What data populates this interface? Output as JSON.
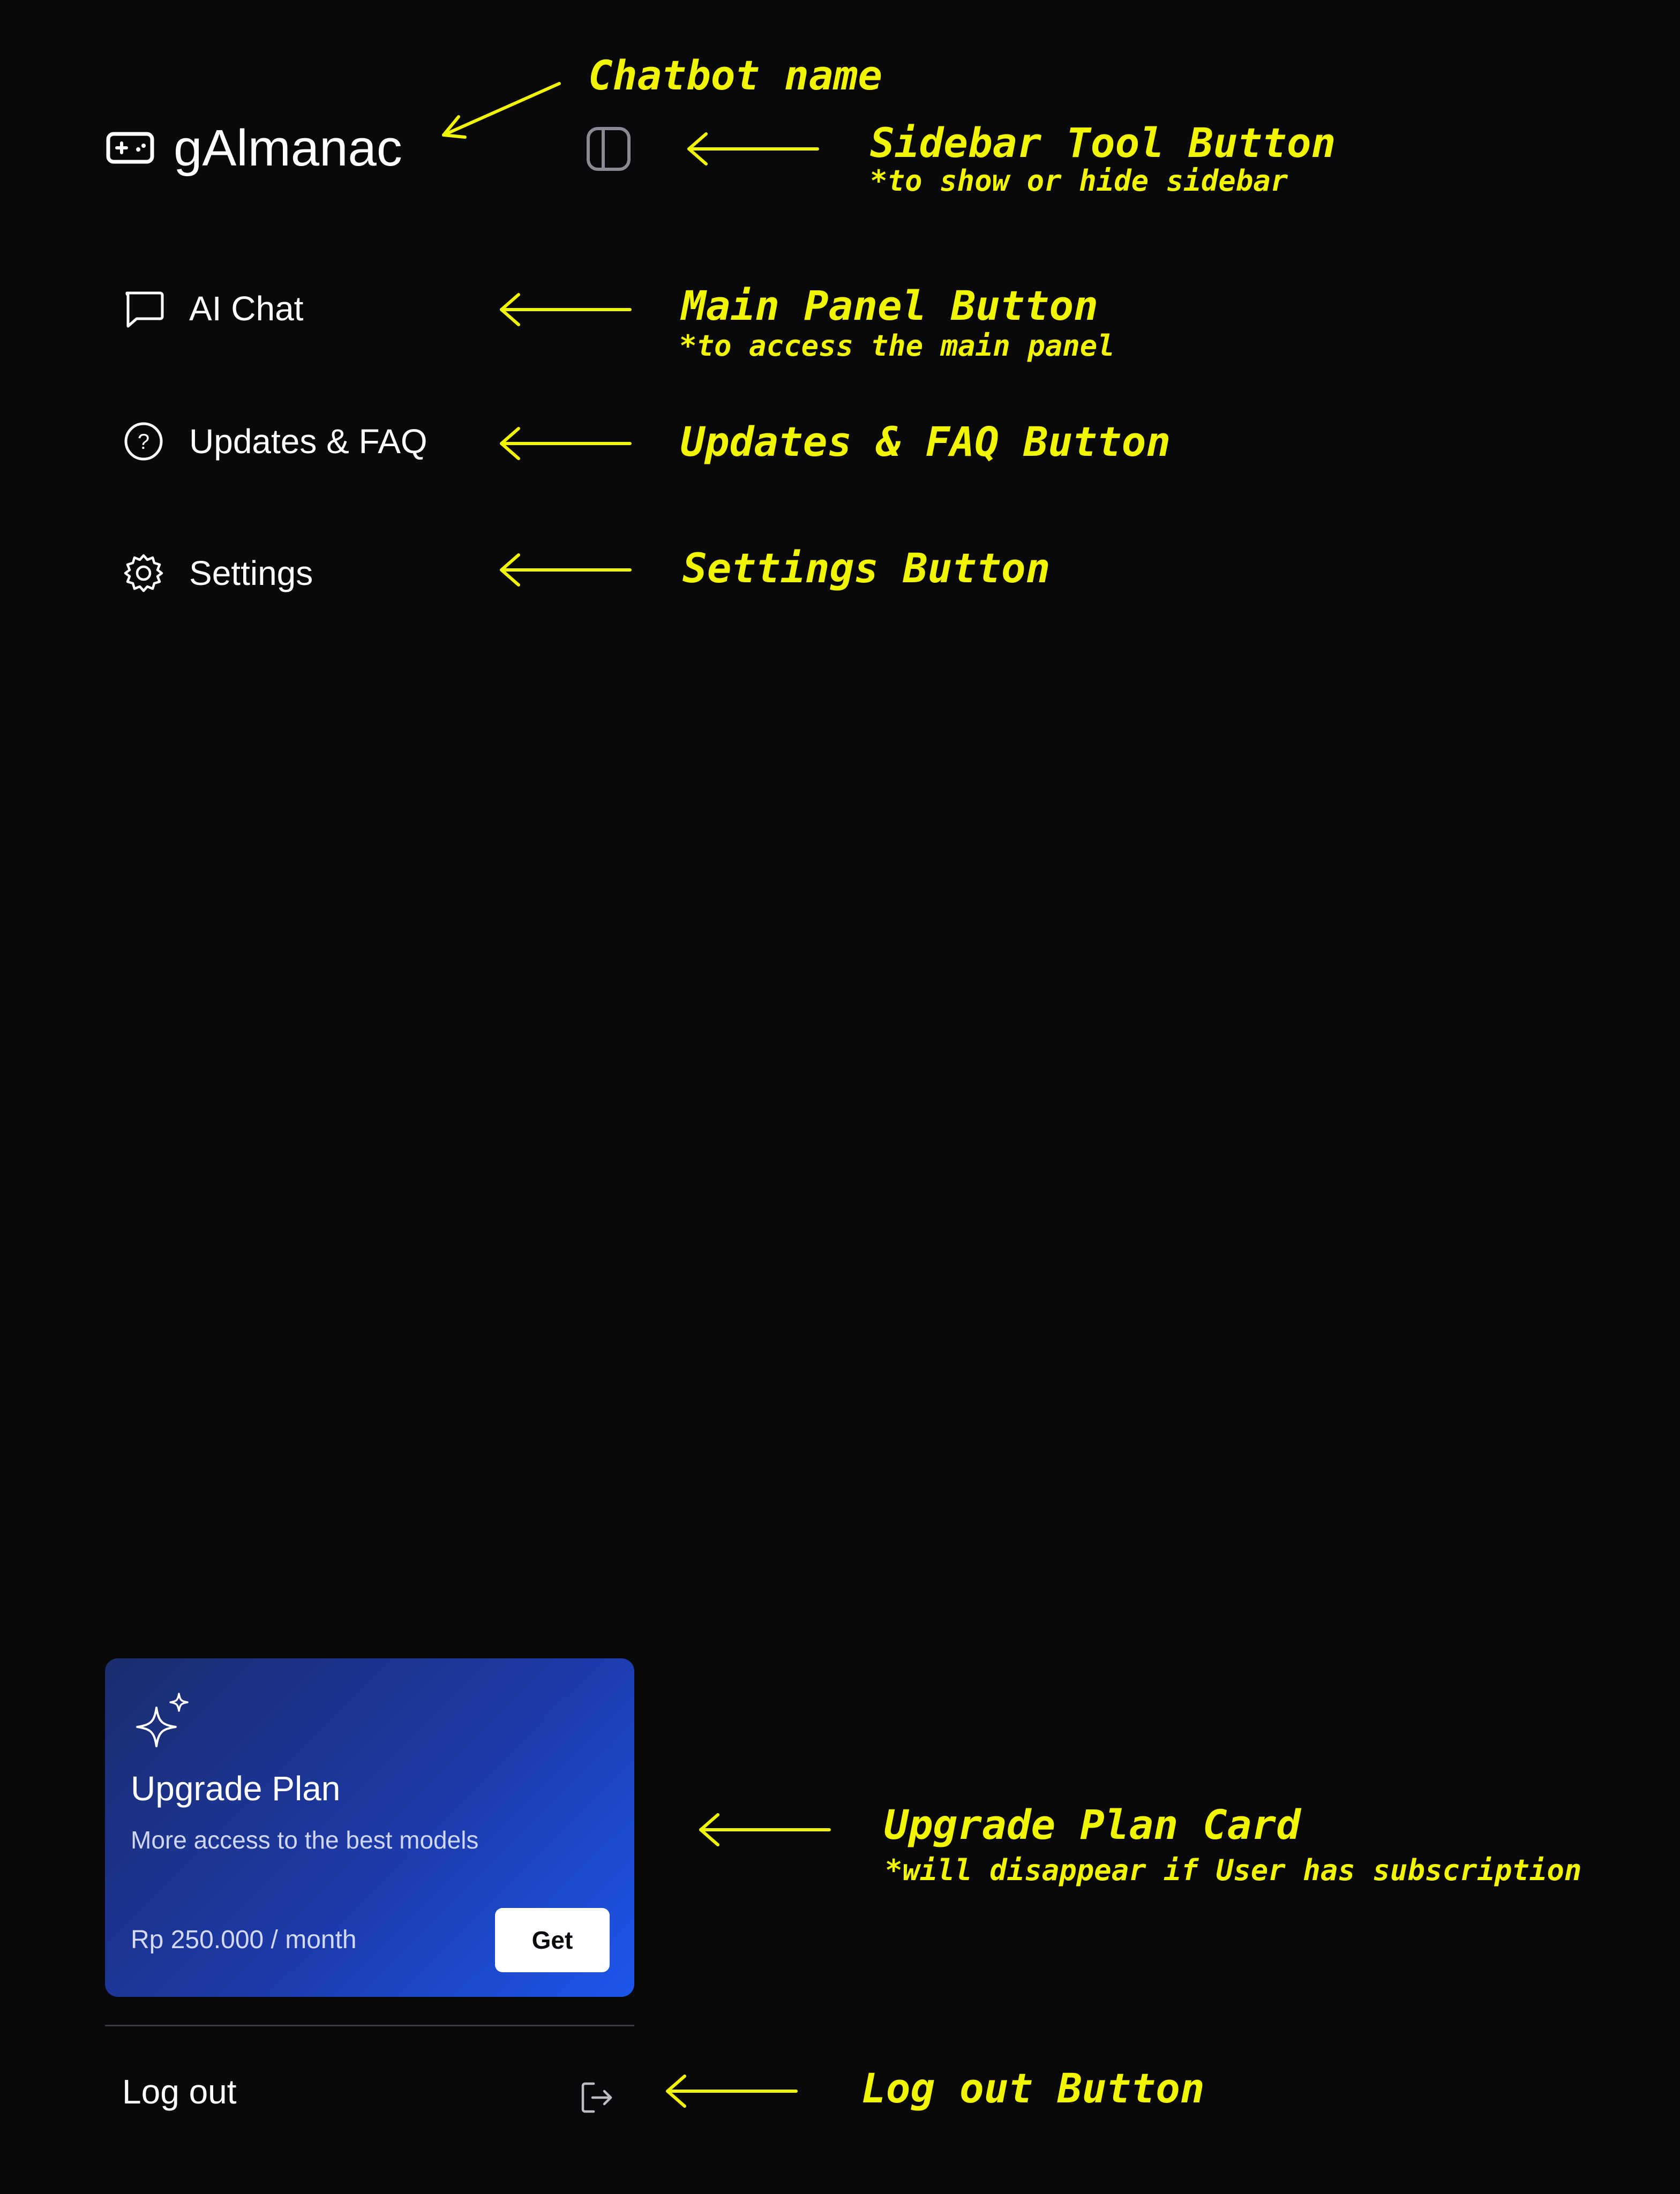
{
  "sidebar": {
    "brand": {
      "icon": "gamepad-icon",
      "name": "gAlmanac"
    },
    "toggle_icon": "sidebar-panel-icon",
    "nav": [
      {
        "icon": "chat-bubble-icon",
        "label": "AI Chat"
      },
      {
        "icon": "question-circle-icon",
        "label": "Updates & FAQ"
      },
      {
        "icon": "gear-icon",
        "label": "Settings"
      }
    ],
    "upgrade_card": {
      "icon": "sparkle-icon",
      "title": "Upgrade Plan",
      "subtitle": "More access to the best models",
      "price": "Rp 250.000 / month",
      "button_label": "Get",
      "colors": {
        "start": "#1b2c6e",
        "end": "#1d56ec"
      }
    },
    "logout": {
      "label": "Log out",
      "icon": "logout-icon"
    }
  },
  "annotations": {
    "color": "#f1f500",
    "chatbot_name": "Chatbot name",
    "sidebar_tool": "Sidebar Tool Button",
    "sidebar_tool_note": "*to show or hide sidebar",
    "main_panel": "Main Panel Button",
    "main_panel_note": "*to access the main panel",
    "updates_faq": "Updates & FAQ Button",
    "settings": "Settings Button",
    "upgrade_card": "Upgrade Plan Card",
    "upgrade_card_note": "*will disappear if User has subscription",
    "logout": "Log out Button"
  },
  "theme": {
    "background": "#09090b",
    "text": "#ffffff"
  }
}
